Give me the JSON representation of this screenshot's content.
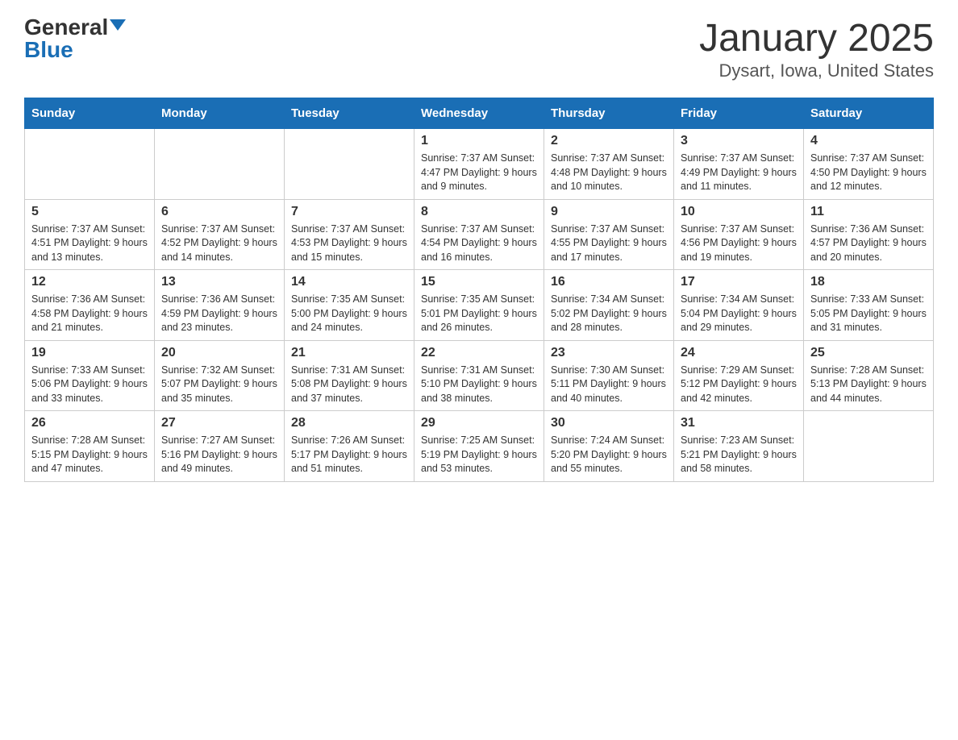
{
  "header": {
    "logo_general": "General",
    "logo_blue": "Blue",
    "month_title": "January 2025",
    "location": "Dysart, Iowa, United States"
  },
  "days_of_week": [
    "Sunday",
    "Monday",
    "Tuesday",
    "Wednesday",
    "Thursday",
    "Friday",
    "Saturday"
  ],
  "weeks": [
    [
      {
        "day": "",
        "info": ""
      },
      {
        "day": "",
        "info": ""
      },
      {
        "day": "",
        "info": ""
      },
      {
        "day": "1",
        "info": "Sunrise: 7:37 AM\nSunset: 4:47 PM\nDaylight: 9 hours\nand 9 minutes."
      },
      {
        "day": "2",
        "info": "Sunrise: 7:37 AM\nSunset: 4:48 PM\nDaylight: 9 hours\nand 10 minutes."
      },
      {
        "day": "3",
        "info": "Sunrise: 7:37 AM\nSunset: 4:49 PM\nDaylight: 9 hours\nand 11 minutes."
      },
      {
        "day": "4",
        "info": "Sunrise: 7:37 AM\nSunset: 4:50 PM\nDaylight: 9 hours\nand 12 minutes."
      }
    ],
    [
      {
        "day": "5",
        "info": "Sunrise: 7:37 AM\nSunset: 4:51 PM\nDaylight: 9 hours\nand 13 minutes."
      },
      {
        "day": "6",
        "info": "Sunrise: 7:37 AM\nSunset: 4:52 PM\nDaylight: 9 hours\nand 14 minutes."
      },
      {
        "day": "7",
        "info": "Sunrise: 7:37 AM\nSunset: 4:53 PM\nDaylight: 9 hours\nand 15 minutes."
      },
      {
        "day": "8",
        "info": "Sunrise: 7:37 AM\nSunset: 4:54 PM\nDaylight: 9 hours\nand 16 minutes."
      },
      {
        "day": "9",
        "info": "Sunrise: 7:37 AM\nSunset: 4:55 PM\nDaylight: 9 hours\nand 17 minutes."
      },
      {
        "day": "10",
        "info": "Sunrise: 7:37 AM\nSunset: 4:56 PM\nDaylight: 9 hours\nand 19 minutes."
      },
      {
        "day": "11",
        "info": "Sunrise: 7:36 AM\nSunset: 4:57 PM\nDaylight: 9 hours\nand 20 minutes."
      }
    ],
    [
      {
        "day": "12",
        "info": "Sunrise: 7:36 AM\nSunset: 4:58 PM\nDaylight: 9 hours\nand 21 minutes."
      },
      {
        "day": "13",
        "info": "Sunrise: 7:36 AM\nSunset: 4:59 PM\nDaylight: 9 hours\nand 23 minutes."
      },
      {
        "day": "14",
        "info": "Sunrise: 7:35 AM\nSunset: 5:00 PM\nDaylight: 9 hours\nand 24 minutes."
      },
      {
        "day": "15",
        "info": "Sunrise: 7:35 AM\nSunset: 5:01 PM\nDaylight: 9 hours\nand 26 minutes."
      },
      {
        "day": "16",
        "info": "Sunrise: 7:34 AM\nSunset: 5:02 PM\nDaylight: 9 hours\nand 28 minutes."
      },
      {
        "day": "17",
        "info": "Sunrise: 7:34 AM\nSunset: 5:04 PM\nDaylight: 9 hours\nand 29 minutes."
      },
      {
        "day": "18",
        "info": "Sunrise: 7:33 AM\nSunset: 5:05 PM\nDaylight: 9 hours\nand 31 minutes."
      }
    ],
    [
      {
        "day": "19",
        "info": "Sunrise: 7:33 AM\nSunset: 5:06 PM\nDaylight: 9 hours\nand 33 minutes."
      },
      {
        "day": "20",
        "info": "Sunrise: 7:32 AM\nSunset: 5:07 PM\nDaylight: 9 hours\nand 35 minutes."
      },
      {
        "day": "21",
        "info": "Sunrise: 7:31 AM\nSunset: 5:08 PM\nDaylight: 9 hours\nand 37 minutes."
      },
      {
        "day": "22",
        "info": "Sunrise: 7:31 AM\nSunset: 5:10 PM\nDaylight: 9 hours\nand 38 minutes."
      },
      {
        "day": "23",
        "info": "Sunrise: 7:30 AM\nSunset: 5:11 PM\nDaylight: 9 hours\nand 40 minutes."
      },
      {
        "day": "24",
        "info": "Sunrise: 7:29 AM\nSunset: 5:12 PM\nDaylight: 9 hours\nand 42 minutes."
      },
      {
        "day": "25",
        "info": "Sunrise: 7:28 AM\nSunset: 5:13 PM\nDaylight: 9 hours\nand 44 minutes."
      }
    ],
    [
      {
        "day": "26",
        "info": "Sunrise: 7:28 AM\nSunset: 5:15 PM\nDaylight: 9 hours\nand 47 minutes."
      },
      {
        "day": "27",
        "info": "Sunrise: 7:27 AM\nSunset: 5:16 PM\nDaylight: 9 hours\nand 49 minutes."
      },
      {
        "day": "28",
        "info": "Sunrise: 7:26 AM\nSunset: 5:17 PM\nDaylight: 9 hours\nand 51 minutes."
      },
      {
        "day": "29",
        "info": "Sunrise: 7:25 AM\nSunset: 5:19 PM\nDaylight: 9 hours\nand 53 minutes."
      },
      {
        "day": "30",
        "info": "Sunrise: 7:24 AM\nSunset: 5:20 PM\nDaylight: 9 hours\nand 55 minutes."
      },
      {
        "day": "31",
        "info": "Sunrise: 7:23 AM\nSunset: 5:21 PM\nDaylight: 9 hours\nand 58 minutes."
      },
      {
        "day": "",
        "info": ""
      }
    ]
  ]
}
